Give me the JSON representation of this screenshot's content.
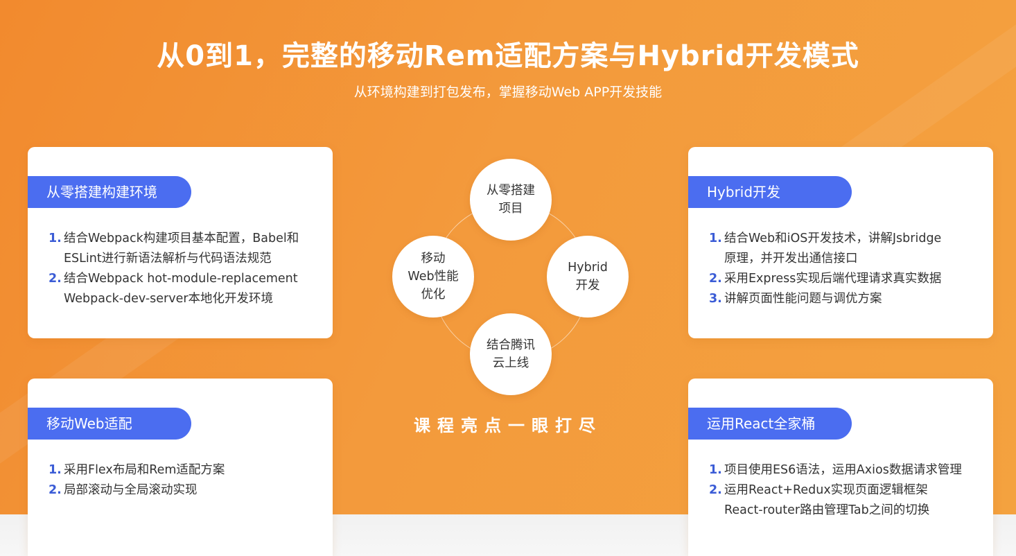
{
  "header": {
    "title": "从0到1，完整的移动Rem适配方案与Hybrid开发模式",
    "subtitle": "从环境构建到打包发布，掌握移动Web APP开发技能"
  },
  "cards": [
    {
      "tag": "从零搭建构建环境",
      "items": [
        {
          "num": "1.",
          "text": "结合Webpack构建项目基本配置，Babel和\nESLint进行新语法解析与代码语法规范"
        },
        {
          "num": "2.",
          "text": "结合Webpack hot-module-replacement\nWebpack-dev-server本地化开发环境"
        }
      ]
    },
    {
      "tag": "Hybrid开发",
      "items": [
        {
          "num": "1.",
          "text": "结合Web和iOS开发技术，讲解Jsbridge\n原理，并开发出通信接口"
        },
        {
          "num": "2.",
          "text": "采用Express实现后端代理请求真实数据"
        },
        {
          "num": "3.",
          "text": "讲解页面性能问题与调优方案"
        }
      ]
    },
    {
      "tag": "移动Web适配",
      "items": [
        {
          "num": "1.",
          "text": "采用Flex布局和Rem适配方案"
        },
        {
          "num": "2.",
          "text": "局部滚动与全局滚动实现"
        }
      ]
    },
    {
      "tag": "运用React全家桶",
      "items": [
        {
          "num": "1.",
          "text": "项目使用ES6语法，运用Axios数据请求管理"
        },
        {
          "num": "2.",
          "text": "运用React+Redux实现页面逻辑框架\nReact-router路由管理Tab之间的切换"
        }
      ]
    }
  ],
  "center": {
    "top": "从零搭建\n项目",
    "left": "移动\nWeb性能\n优化",
    "right": "Hybrid\n开发",
    "bottom": "结合腾讯\n云上线",
    "slogan": "课程亮点一眼打尽"
  },
  "colors": {
    "background": "#f39a3c",
    "accent": "#4b6df0",
    "number": "#3b5cd6"
  }
}
